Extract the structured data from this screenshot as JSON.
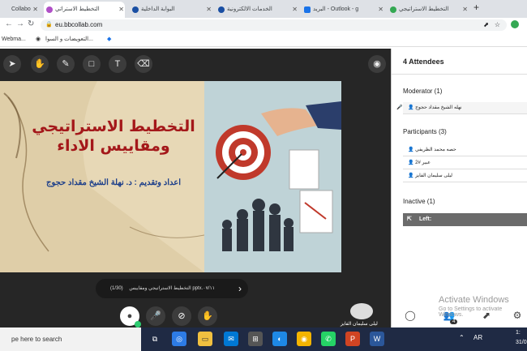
{
  "browser": {
    "tabs": [
      {
        "label": "Collabo",
        "color": "#3b6fd8"
      },
      {
        "label": "التخطيط الاستراتي",
        "color": "#b04fc7"
      },
      {
        "label": "البوابة الداخلية",
        "color": "#1a4fa3"
      },
      {
        "label": "الخدمات الالكترونية",
        "color": "#1a4fa3"
      },
      {
        "label": "البريد - Outlook - g",
        "color": "#1a73e8"
      },
      {
        "label": "التخطيط الاستراتيجي",
        "color": "#34a853"
      }
    ],
    "new_tab": "+",
    "url": "eu.bbcollab.com",
    "bookmarks": [
      "Webma...",
      "التعويضات و السوا..."
    ]
  },
  "stage": {
    "tools": [
      "pointer-icon",
      "hand-icon",
      "pen-icon",
      "rect-icon",
      "text-icon",
      "eraser-icon"
    ],
    "slide": {
      "title_line1": "التخطيط الاستراتيجي",
      "title_line2": "ومقاييس الاداء",
      "author": "اعداد وتقديم : د. نهلة الشيخ مقداد حجوج"
    },
    "pager": {
      "text": "التخطيط الاستراتيجي ومقاييس pptx.٠٧/١١",
      "page": "(1/30)"
    },
    "presenter_name": "ليلى سليمان الفايز"
  },
  "panel": {
    "title": "4 Attendees",
    "moderator_header": "Moderator (1)",
    "moderator": "نهله الشيخ مقداد حجوج",
    "participants_header": "Participants (3)",
    "participants": [
      "حصه محمد الظريفي",
      "عبير #2",
      "ليلى سليمان الفايز"
    ],
    "inactive_header": "Inactive (1)",
    "inactive_label": "Left:",
    "badge_count": "4"
  },
  "watermark": {
    "line1": "Activate Windows",
    "line2": "Go to Settings to activate Windows."
  },
  "taskbar": {
    "search_placeholder": "pe here to search",
    "lang": "AR",
    "time": "1:",
    "date": "31/0"
  }
}
